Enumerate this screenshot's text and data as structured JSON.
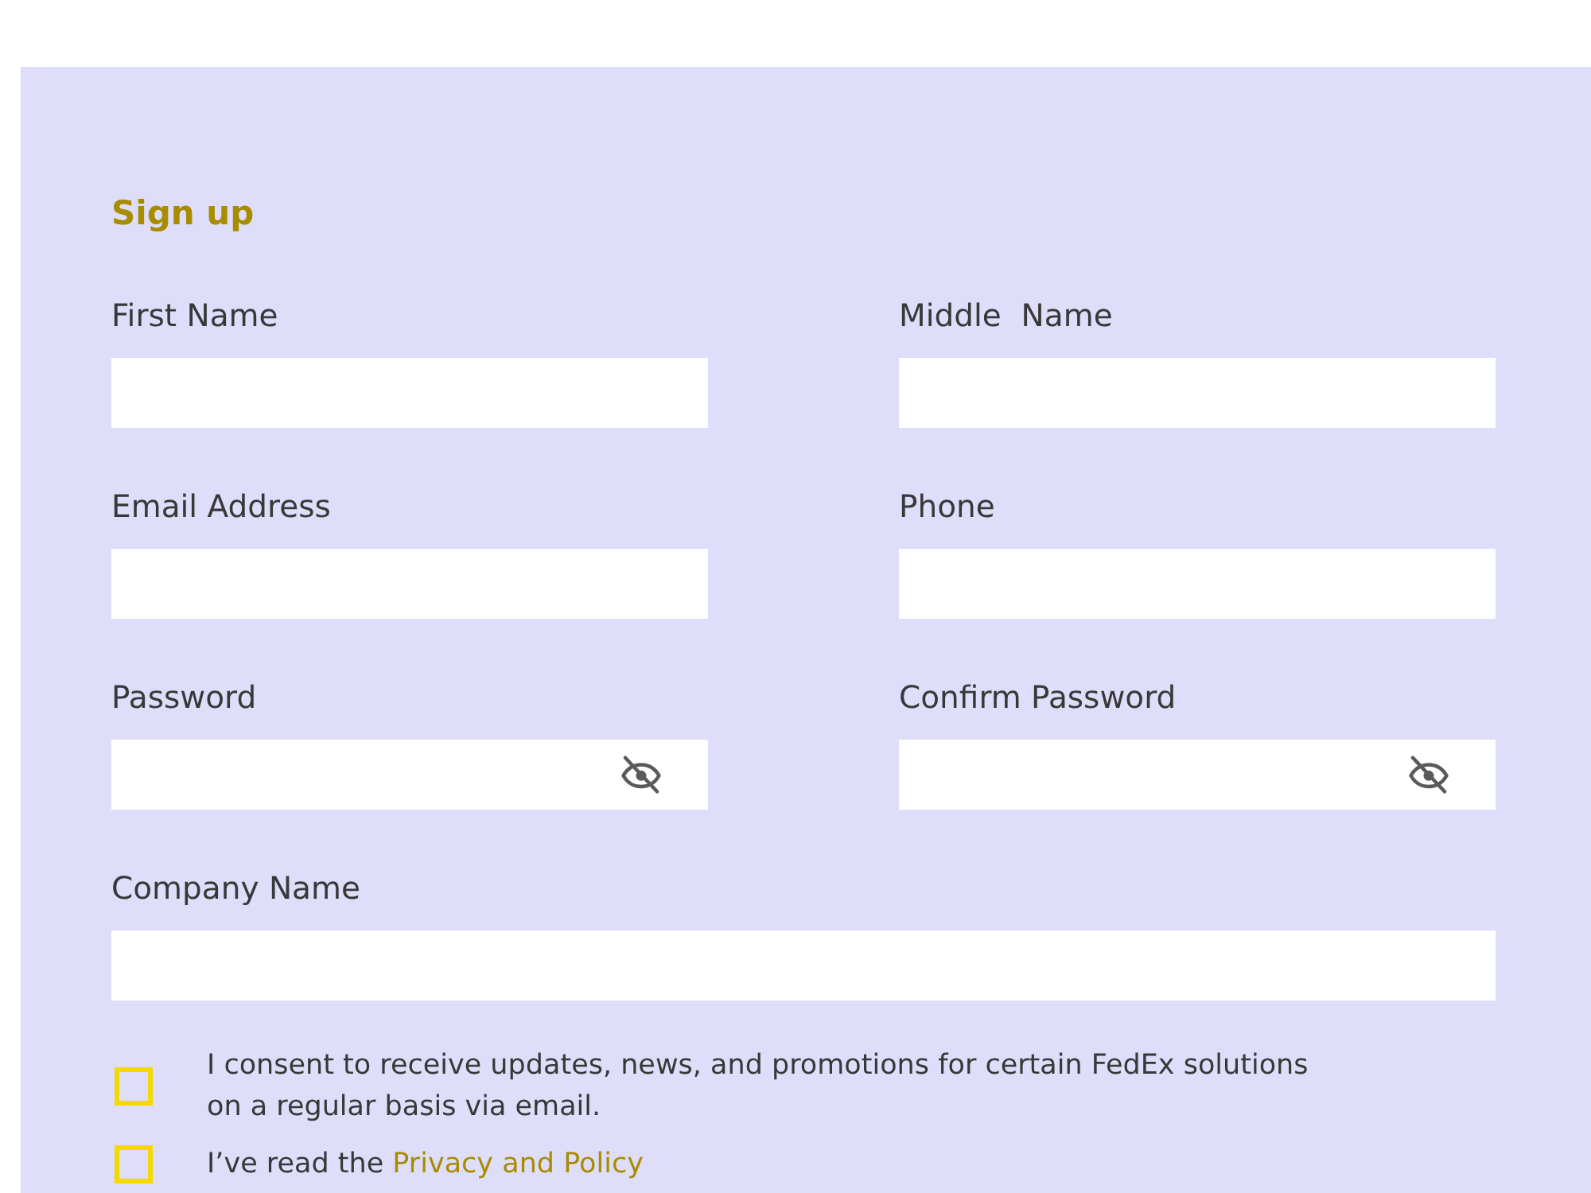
{
  "form": {
    "title": "Sign up",
    "rows": [
      {
        "fields": [
          {
            "label": "First Name",
            "kind": "text"
          },
          {
            "label": "Middle  Name",
            "kind": "text"
          }
        ]
      },
      {
        "fields": [
          {
            "label": "Email Address",
            "kind": "text"
          },
          {
            "label": "Phone",
            "kind": "text"
          }
        ]
      },
      {
        "fields": [
          {
            "label": "Password",
            "kind": "password"
          },
          {
            "label": "Confirm Password",
            "kind": "password"
          }
        ]
      },
      {
        "fields": [
          {
            "label": "Company Name",
            "kind": "text"
          }
        ]
      }
    ],
    "consents": [
      {
        "text": "I consent to receive updates, news, and promotions for certain FedEx solutions on a regular basis via email.",
        "checked": false
      },
      {
        "text": "I’ve read the ",
        "link": "Privacy and Policy",
        "checked": false
      }
    ]
  }
}
